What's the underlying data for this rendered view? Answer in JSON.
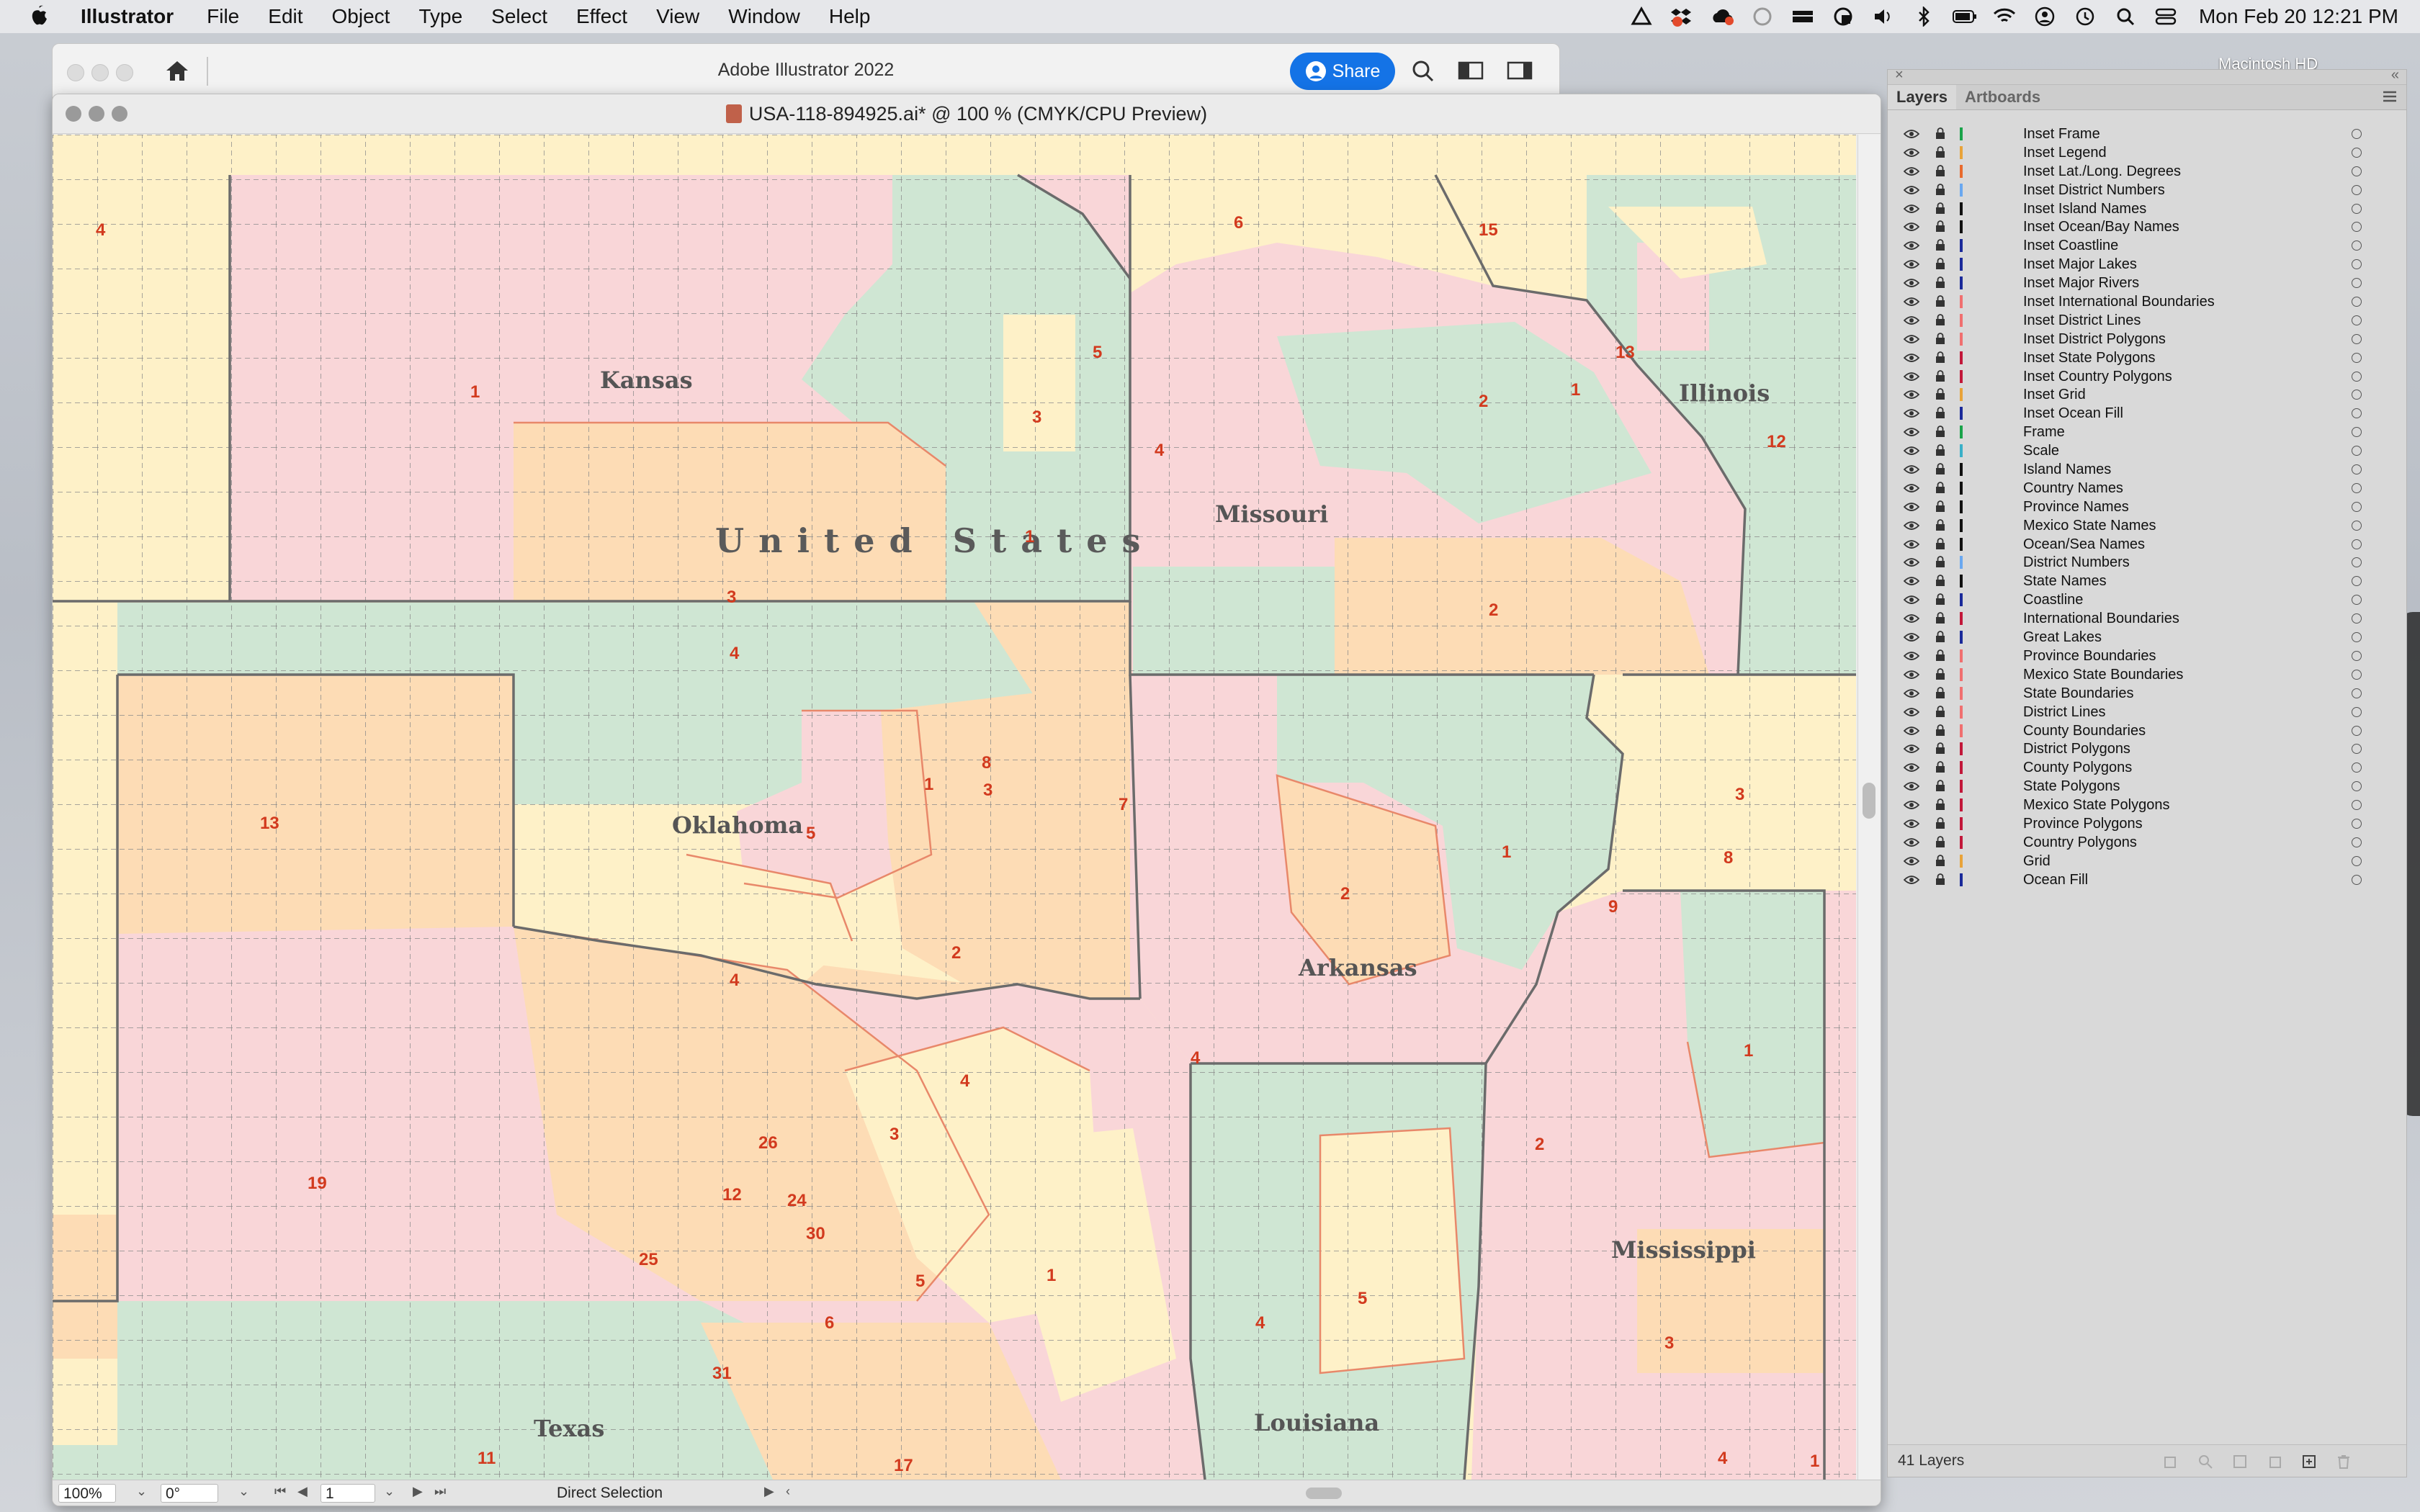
{
  "menubar": {
    "app_name": "Illustrator",
    "items": [
      "File",
      "Edit",
      "Object",
      "Type",
      "Select",
      "Effect",
      "View",
      "Window",
      "Help"
    ],
    "clock": "Mon Feb 20  12:21 PM"
  },
  "desktop": {
    "disk_label": "Macintosh HD"
  },
  "app": {
    "title": "Adobe Illustrator 2022",
    "share_label": "Share"
  },
  "document": {
    "title": "USA-118-894925.ai* @ 100 % (CMYK/CPU Preview)"
  },
  "map": {
    "country_label": "United States",
    "states": [
      {
        "name": "Kansas"
      },
      {
        "name": "Missouri"
      },
      {
        "name": "Illinois"
      },
      {
        "name": "Oklahoma"
      },
      {
        "name": "Arkansas"
      },
      {
        "name": "Mississippi"
      },
      {
        "name": "Texas"
      },
      {
        "name": "Louisiana"
      }
    ],
    "district_numbers": [
      "4",
      "6",
      "15",
      "13",
      "1",
      "5",
      "3",
      "2",
      "1",
      "4",
      "12",
      "1",
      "3",
      "4",
      "2",
      "8",
      "7",
      "3",
      "1",
      "3",
      "8",
      "13",
      "1",
      "5",
      "2",
      "9",
      "2",
      "4",
      "4",
      "1",
      "4",
      "3",
      "26",
      "19",
      "12",
      "24",
      "30",
      "25",
      "5",
      "1",
      "6",
      "4",
      "5",
      "2",
      "3",
      "31",
      "11",
      "17",
      "4",
      "1"
    ],
    "colors": {
      "pink": "#f9d6d8",
      "orange": "#fddcb5",
      "green": "#cfe6d3",
      "yellow": "#fef1c8",
      "district_line": "#e8886a",
      "state_line": "#6b6b6b"
    }
  },
  "statusbar": {
    "zoom": "100%",
    "rotation": "0°",
    "artboard": "1",
    "tool": "Direct Selection"
  },
  "layers_panel": {
    "tabs": [
      "Layers",
      "Artboards"
    ],
    "layers": [
      {
        "name": "Inset Frame",
        "color": "#1aa34a"
      },
      {
        "name": "Inset Legend",
        "color": "#e8a33a"
      },
      {
        "name": "Inset Lat./Long. Degrees",
        "color": "#e86b2e"
      },
      {
        "name": "Inset District Numbers",
        "color": "#6aa8f0"
      },
      {
        "name": "Inset Island Names",
        "color": "#111111"
      },
      {
        "name": "Inset Ocean/Bay Names",
        "color": "#111111"
      },
      {
        "name": "Inset Coastline",
        "color": "#1a2a9a"
      },
      {
        "name": "Inset Major Lakes",
        "color": "#1a2a9a"
      },
      {
        "name": "Inset Major Rivers",
        "color": "#1a2a9a"
      },
      {
        "name": "Inset International Boundaries",
        "color": "#f07070"
      },
      {
        "name": "Inset District Lines",
        "color": "#f07070"
      },
      {
        "name": "Inset District Polygons",
        "color": "#f07070"
      },
      {
        "name": "Inset State Polygons",
        "color": "#c2183a"
      },
      {
        "name": "Inset Country Polygons",
        "color": "#c2183a"
      },
      {
        "name": "Inset Grid",
        "color": "#e8a33a"
      },
      {
        "name": "Inset Ocean Fill",
        "color": "#1a2a9a"
      },
      {
        "name": "Frame",
        "color": "#1aa34a"
      },
      {
        "name": "Scale",
        "color": "#3ab0c8"
      },
      {
        "name": "Island Names",
        "color": "#111111"
      },
      {
        "name": "Country Names",
        "color": "#111111"
      },
      {
        "name": "Province Names",
        "color": "#111111"
      },
      {
        "name": "Mexico State Names",
        "color": "#111111"
      },
      {
        "name": "Ocean/Sea Names",
        "color": "#111111"
      },
      {
        "name": "District Numbers",
        "color": "#6aa8f0"
      },
      {
        "name": "State Names",
        "color": "#111111"
      },
      {
        "name": "Coastline",
        "color": "#1a2a9a"
      },
      {
        "name": "International Boundaries",
        "color": "#c2183a"
      },
      {
        "name": "Great Lakes",
        "color": "#1a2a9a"
      },
      {
        "name": "Province Boundaries",
        "color": "#f07070"
      },
      {
        "name": "Mexico State Boundaries",
        "color": "#f07070"
      },
      {
        "name": "State Boundaries",
        "color": "#f07070"
      },
      {
        "name": "District Lines",
        "color": "#f07070"
      },
      {
        "name": "County Boundaries",
        "color": "#f07070"
      },
      {
        "name": "District Polygons",
        "color": "#c2183a"
      },
      {
        "name": "County Polygons",
        "color": "#c2183a"
      },
      {
        "name": "State Polygons",
        "color": "#c2183a"
      },
      {
        "name": "Mexico State Polygons",
        "color": "#c2183a"
      },
      {
        "name": "Province Polygons",
        "color": "#c2183a"
      },
      {
        "name": "Country Polygons",
        "color": "#c2183a"
      },
      {
        "name": "Grid",
        "color": "#e8a33a"
      },
      {
        "name": "Ocean Fill",
        "color": "#1a2a9a"
      }
    ],
    "layer_count": "41 Layers"
  }
}
